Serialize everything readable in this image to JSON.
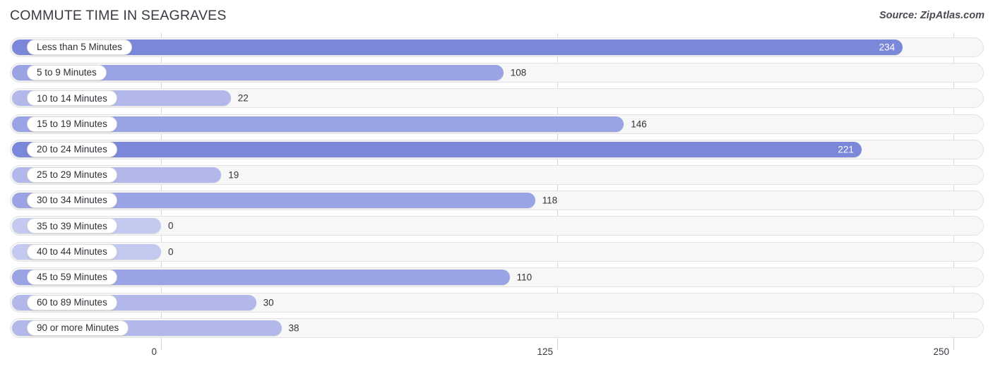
{
  "header": {
    "title": "COMMUTE TIME IN SEAGRAVES",
    "source": "Source: ZipAtlas.com"
  },
  "colors": {
    "bar_high": "#7b87d8",
    "bar_mid": "#9aa3e3",
    "bar_low": "#b2b9ea",
    "bar_zero": "#c3c9ef",
    "track_bg": "#f7f7f7",
    "track_border": "#e3e3e3",
    "gridline": "#d8d8d8",
    "value_in": "#ffffff",
    "value_out": "#33333a"
  },
  "chart_data": {
    "type": "bar",
    "orientation": "horizontal",
    "title": "COMMUTE TIME IN SEAGRAVES",
    "xlabel": "",
    "ylabel": "",
    "xlim": [
      0,
      250
    ],
    "xticks": [
      0,
      125,
      250
    ],
    "xtick_labels": [
      "0",
      "125",
      "250"
    ],
    "grid": true,
    "legend": false,
    "categories": [
      "Less than 5 Minutes",
      "5 to 9 Minutes",
      "10 to 14 Minutes",
      "15 to 19 Minutes",
      "20 to 24 Minutes",
      "25 to 29 Minutes",
      "30 to 34 Minutes",
      "35 to 39 Minutes",
      "40 to 44 Minutes",
      "45 to 59 Minutes",
      "60 to 89 Minutes",
      "90 or more Minutes"
    ],
    "values": [
      234,
      108,
      22,
      146,
      221,
      19,
      118,
      0,
      0,
      110,
      30,
      38
    ],
    "value_labels": [
      "234",
      "108",
      "22",
      "146",
      "221",
      "19",
      "118",
      "0",
      "0",
      "110",
      "30",
      "38"
    ],
    "label_inside": [
      true,
      false,
      false,
      false,
      true,
      false,
      false,
      false,
      false,
      false,
      false,
      false
    ]
  }
}
